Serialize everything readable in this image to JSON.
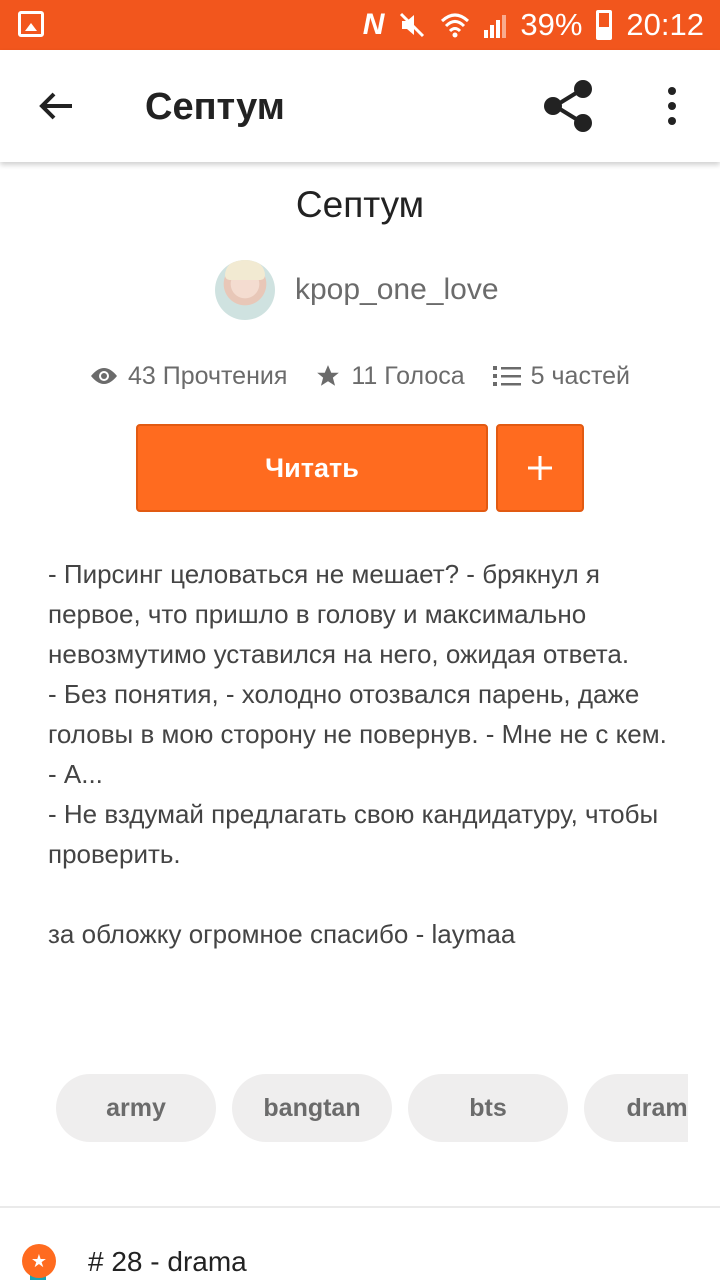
{
  "status_bar": {
    "battery": "39%",
    "time": "20:12",
    "n_label": "N"
  },
  "appbar": {
    "title": "Септум"
  },
  "story": {
    "title": "Септум",
    "author": "kpop_one_love",
    "stats": {
      "reads": "43 Прочтения",
      "votes": "11 Голоса",
      "parts": "5 частей"
    },
    "read_button": "Читать",
    "add_button": "+",
    "description": "- Пирсинг целоваться не мешает? - брякнул я первое, что пришло в голову и максимально невозмутимо уставился на него, ожидая ответа.\n- Без понятия, - холодно отозвался парень, даже головы в мою сторону не повернув. - Мне не с кем.\n- А...\n- Не вздумай предлагать свою кандидатуру, чтобы проверить.\n\nза обложку огромное спасибо - laymaa",
    "tags": [
      "army",
      "bangtan",
      "bts",
      "drama"
    ],
    "ranking": "# 28 - drama"
  },
  "colors": {
    "accent": "#f2561d",
    "button": "#ff6b1f",
    "ribbon": "#19a5b4"
  }
}
